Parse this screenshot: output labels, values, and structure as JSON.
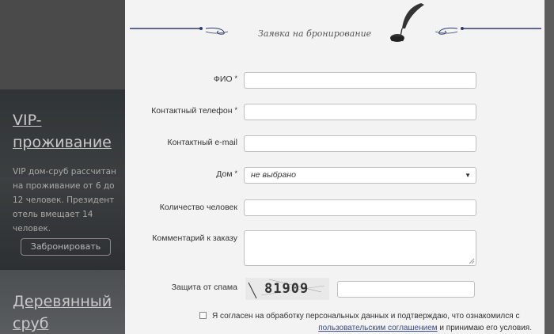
{
  "background": {
    "vip": {
      "title": "VIP-проживание",
      "description": "VIP дом-сруб рассчитан на проживание от 6 до 12 человек. Президент отель вмещает 14 человек.",
      "book_button": "Забронировать"
    },
    "wood": {
      "title": "Деревянный сруб"
    }
  },
  "modal": {
    "title": "Заявка на бронирование",
    "fields": {
      "fio": {
        "label": "ФИО",
        "required": "*",
        "value": ""
      },
      "phone": {
        "label": "Контактный телефон",
        "required": "*",
        "value": ""
      },
      "email": {
        "label": "Контактный e-mail",
        "value": ""
      },
      "house": {
        "label": "Дом",
        "required": "*",
        "selected": "не выбрано"
      },
      "people": {
        "label": "Количество человек",
        "value": ""
      },
      "comment": {
        "label": "Комментарий к заказу",
        "value": ""
      },
      "captcha": {
        "label": "Защита от спама",
        "code": "81909",
        "value": ""
      }
    },
    "consent": {
      "text1": "Я согласен на обработку персональных данных и подтверждаю, что ознакомился с",
      "link": "пользовательским соглашением",
      "text2": " и принимаю его условия."
    }
  },
  "colors": {
    "accent": "#3a4a8a",
    "modal_bg": "#f3f3f3",
    "overlay": "#4a4a4a"
  }
}
